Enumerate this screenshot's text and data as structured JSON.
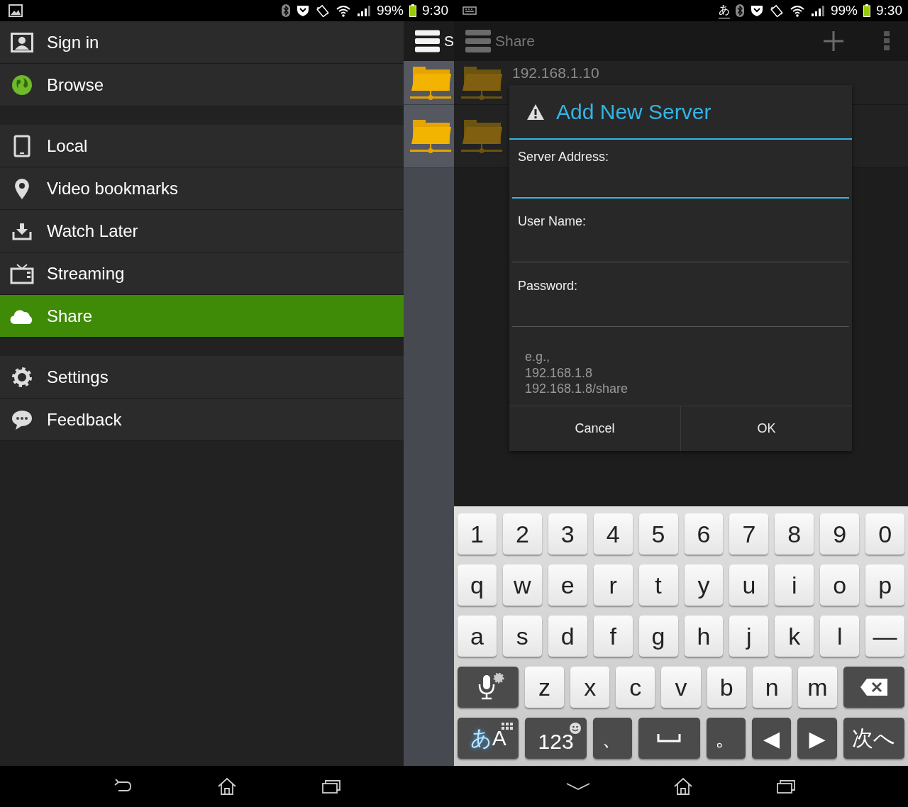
{
  "status_bars": [
    {
      "battery": "99%",
      "time": "9:30"
    },
    {
      "ime_indicator": "あ",
      "battery": "99%",
      "time": "9:30"
    }
  ],
  "drawer": {
    "sections": [
      {
        "items": [
          {
            "label": "Sign in",
            "selected": false
          },
          {
            "label": "Browse",
            "selected": false
          }
        ]
      },
      {
        "items": [
          {
            "label": "Local",
            "selected": false
          },
          {
            "label": "Video bookmarks",
            "selected": false
          },
          {
            "label": "Watch Later",
            "selected": false
          },
          {
            "label": "Streaming",
            "selected": false
          },
          {
            "label": "Share",
            "selected": true
          }
        ]
      },
      {
        "items": [
          {
            "label": "Settings",
            "selected": false
          },
          {
            "label": "Feedback",
            "selected": false
          }
        ]
      }
    ]
  },
  "background_app": {
    "title": "S"
  },
  "share_screen": {
    "title": "Share",
    "rows": [
      {
        "label": "192.168.1.10"
      }
    ]
  },
  "dialog": {
    "title": "Add New Server",
    "fields": [
      {
        "label": "Server Address:",
        "focused": true
      },
      {
        "label": "User Name:",
        "focused": false
      },
      {
        "label": "Password:",
        "focused": false
      }
    ],
    "hint_lines": [
      "e.g.,",
      "192.168.1.8",
      "192.168.1.8/share"
    ],
    "buttons": [
      "Cancel",
      "OK"
    ]
  },
  "keyboard": {
    "rows": [
      {
        "keys": [
          {
            "kind": "light",
            "label": "1"
          },
          {
            "kind": "light",
            "label": "2"
          },
          {
            "kind": "light",
            "label": "3"
          },
          {
            "kind": "light",
            "label": "4"
          },
          {
            "kind": "light",
            "label": "5"
          },
          {
            "kind": "light",
            "label": "6"
          },
          {
            "kind": "light",
            "label": "7"
          },
          {
            "kind": "light",
            "label": "8"
          },
          {
            "kind": "light",
            "label": "9"
          },
          {
            "kind": "light",
            "label": "0"
          }
        ]
      },
      {
        "keys": [
          {
            "kind": "light",
            "label": "q"
          },
          {
            "kind": "light",
            "label": "w"
          },
          {
            "kind": "light",
            "label": "e"
          },
          {
            "kind": "light",
            "label": "r"
          },
          {
            "kind": "light",
            "label": "t"
          },
          {
            "kind": "light",
            "label": "y"
          },
          {
            "kind": "light",
            "label": "u"
          },
          {
            "kind": "light",
            "label": "i"
          },
          {
            "kind": "light",
            "label": "o"
          },
          {
            "kind": "light",
            "label": "p"
          }
        ]
      },
      {
        "keys": [
          {
            "kind": "light",
            "label": "a"
          },
          {
            "kind": "light",
            "label": "s"
          },
          {
            "kind": "light",
            "label": "d"
          },
          {
            "kind": "light",
            "label": "f"
          },
          {
            "kind": "light",
            "label": "g"
          },
          {
            "kind": "light",
            "label": "h"
          },
          {
            "kind": "light",
            "label": "j"
          },
          {
            "kind": "light",
            "label": "k"
          },
          {
            "kind": "light",
            "label": "l"
          },
          {
            "kind": "light",
            "label": "—"
          }
        ]
      },
      {
        "keys": [
          {
            "kind": "mic"
          },
          {
            "kind": "light",
            "label": "z"
          },
          {
            "kind": "light",
            "label": "x"
          },
          {
            "kind": "light",
            "label": "c"
          },
          {
            "kind": "light",
            "label": "v"
          },
          {
            "kind": "light",
            "label": "b"
          },
          {
            "kind": "light",
            "label": "n"
          },
          {
            "kind": "light",
            "label": "m"
          },
          {
            "kind": "backspace"
          }
        ]
      },
      {
        "keys": [
          {
            "kind": "ime",
            "accent": "あ",
            "label": "A"
          },
          {
            "kind": "numsym",
            "label": "123"
          },
          {
            "kind": "dark",
            "label": "、"
          },
          {
            "kind": "space"
          },
          {
            "kind": "dark",
            "label": "。"
          },
          {
            "kind": "dark",
            "label": "◀"
          },
          {
            "kind": "dark",
            "label": "▶"
          },
          {
            "kind": "action",
            "label": "次へ"
          }
        ]
      }
    ]
  }
}
